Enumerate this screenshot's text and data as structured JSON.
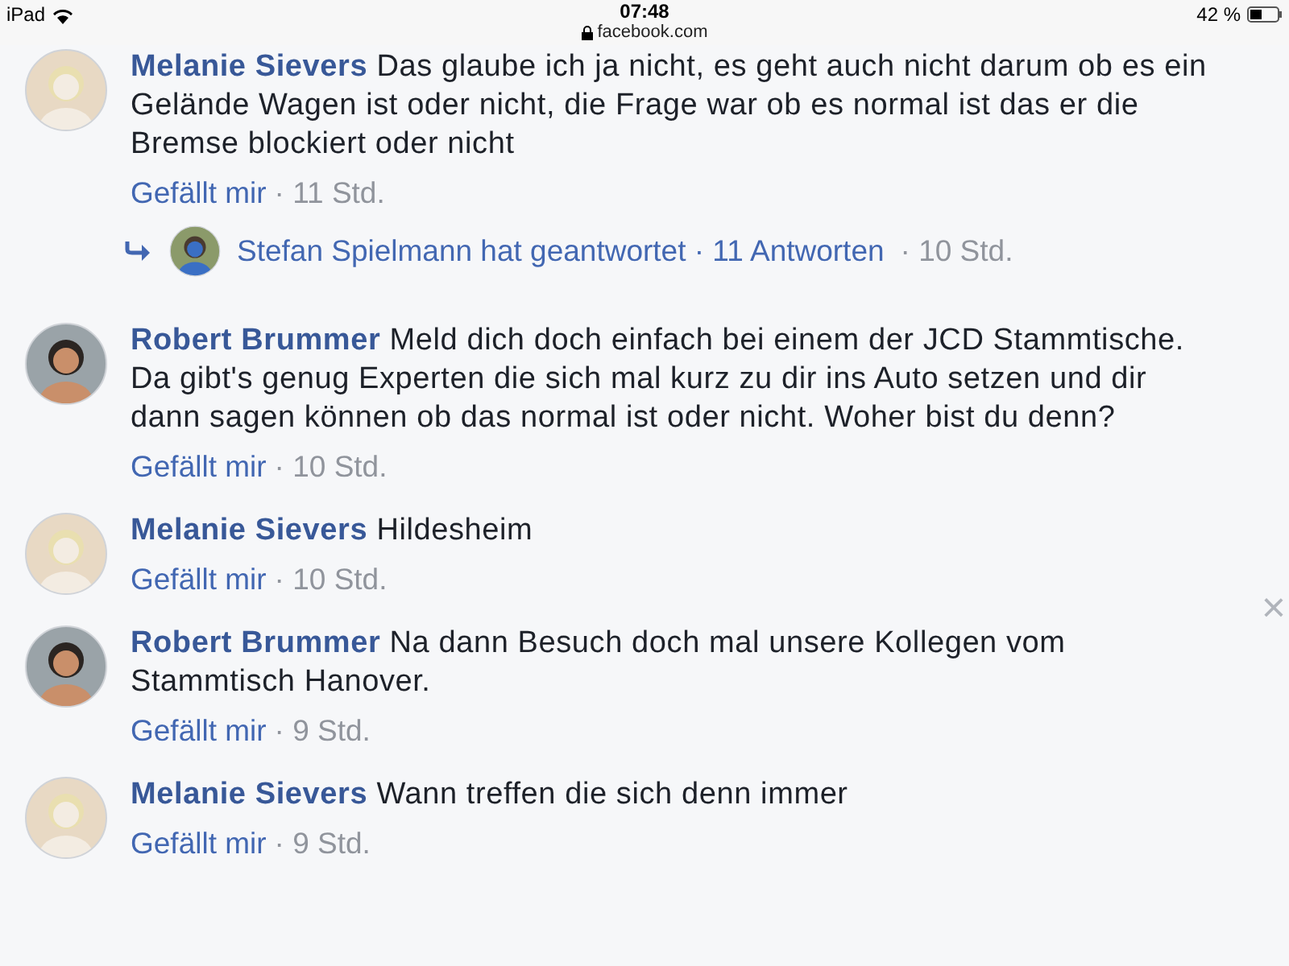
{
  "status_bar": {
    "device": "iPad",
    "time": "07:48",
    "url": "facebook.com",
    "battery": "42 %"
  },
  "comments": [
    {
      "author": "Melanie Sievers",
      "text": "Das glaube ich ja nicht, es geht auch nicht darum ob es ein Gelände Wagen ist oder nicht, die Frage war ob es normal ist das er die Bremse blockiert oder nicht",
      "like": "Gefällt mir",
      "time": "· 11 Std.",
      "kind": "light",
      "reply": {
        "text": "Stefan Spielmann hat geantwortet · 11 Antworten",
        "time": "· 10 Std."
      }
    },
    {
      "author": "Robert Brummer",
      "text": "Meld dich doch einfach bei einem der JCD Stammtische. Da gibt's genug Experten die sich mal kurz zu dir ins Auto setzen und dir dann sagen können ob das normal ist oder nicht. Woher bist du denn?",
      "like": "Gefällt mir",
      "time": "· 10 Std.",
      "kind": "dark"
    },
    {
      "author": "Melanie Sievers",
      "text": "Hildesheim",
      "like": "Gefällt mir",
      "time": "· 10 Std.",
      "kind": "light"
    },
    {
      "author": "Robert Brummer",
      "text": "Na dann Besuch doch mal unsere Kollegen vom Stammtisch Hanover.",
      "like": "Gefällt mir",
      "time": "· 9 Std.",
      "kind": "dark"
    },
    {
      "author": "Melanie Sievers",
      "text": "Wann treffen die sich denn immer",
      "like": "Gefällt mir",
      "time": "· 9 Std.",
      "kind": "light"
    }
  ],
  "close": "×"
}
